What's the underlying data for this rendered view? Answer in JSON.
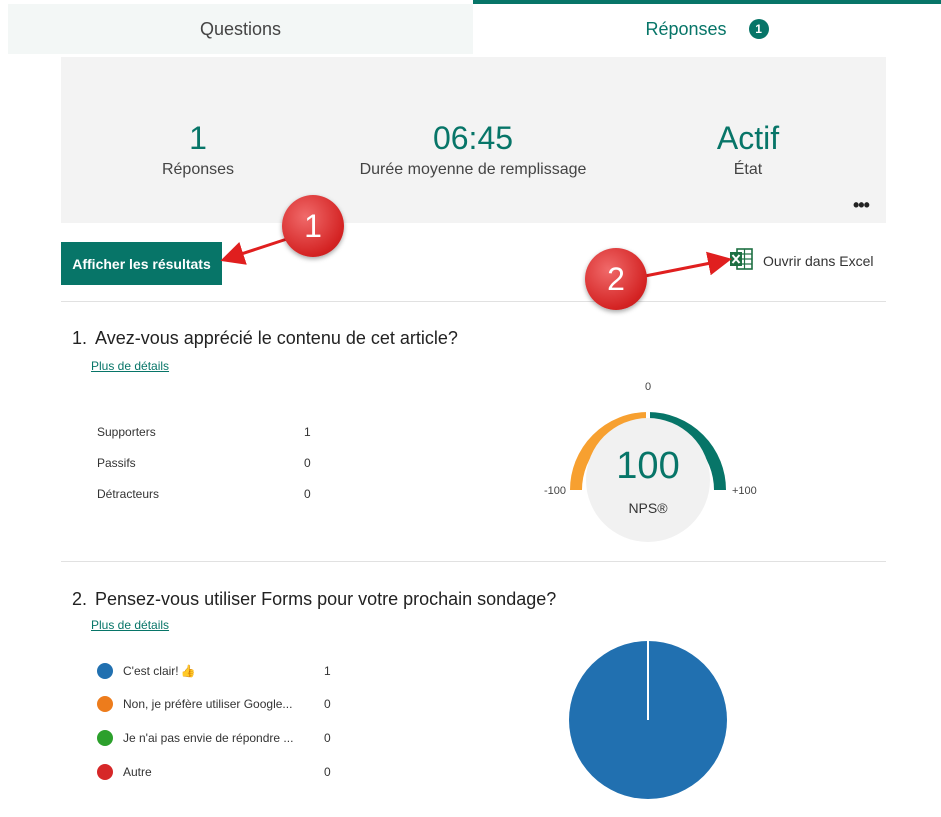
{
  "tabs": {
    "questions_label": "Questions",
    "responses_label": "Réponses",
    "responses_badge": "1"
  },
  "summary": {
    "responses_value": "1",
    "responses_label": "Réponses",
    "duration_value": "06:45",
    "duration_label": "Durée moyenne de remplissage",
    "status_value": "Actif",
    "status_label": "État",
    "more_label": "•••"
  },
  "actions": {
    "results_button": "Afficher les résultats",
    "excel_label": "Ouvrir dans Excel"
  },
  "callouts": [
    "1",
    "2"
  ],
  "question1": {
    "number": "1.",
    "title": "Avez-vous apprécié le contenu de cet article?",
    "details_link": "Plus de détails",
    "rows": [
      {
        "label": "Supporters",
        "count": "1"
      },
      {
        "label": "Passifs",
        "count": "0"
      },
      {
        "label": "Détracteurs",
        "count": "0"
      }
    ],
    "gauge": {
      "score": "100",
      "caption": "NPS®",
      "min_label": "-100",
      "mid_label": "0",
      "max_label": "+100"
    }
  },
  "question2": {
    "number": "2.",
    "title": "Pensez-vous utiliser Forms pour votre prochain sondage?",
    "details_link": "Plus de détails",
    "options": [
      {
        "label": "C'est clair!",
        "count": "1",
        "color": "#2170b0"
      },
      {
        "label": "Non, je préfère utiliser Google...",
        "count": "0",
        "color": "#ed7c1c"
      },
      {
        "label": "Je n'ai pas envie de répondre ...",
        "count": "0",
        "color": "#2ca02c"
      },
      {
        "label": "Autre",
        "count": "0",
        "color": "#d62728"
      }
    ]
  },
  "colors": {
    "accent": "#077568",
    "gauge_orange": "#f7a030",
    "gauge_teal": "#077568",
    "callout_red": "#d42323"
  }
}
